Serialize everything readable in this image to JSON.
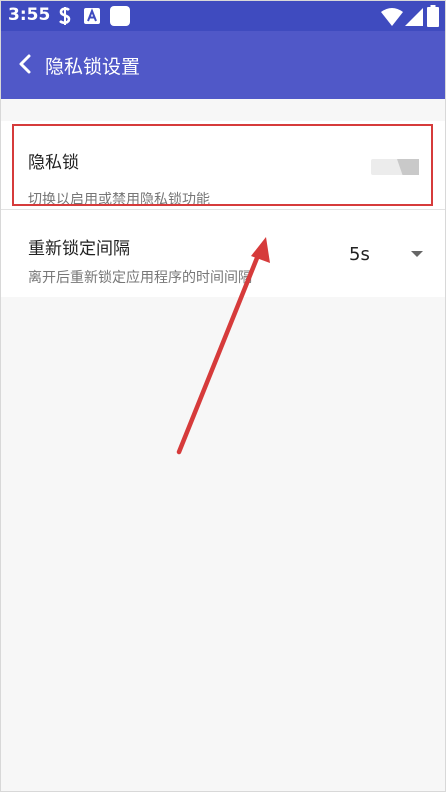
{
  "status_bar": {
    "time": "3:55",
    "icons": [
      "dollar-icon",
      "font-a-icon",
      "app-square-icon",
      "wifi-icon",
      "signal-icon",
      "battery-icon"
    ]
  },
  "app_bar": {
    "back_icon": "chevron-left-icon",
    "title": "隐私锁设置"
  },
  "settings": {
    "privacy_lock": {
      "title": "隐私锁",
      "summary": "切换以启用或禁用隐私锁功能",
      "enabled": false
    },
    "relock_interval": {
      "title": "重新锁定间隔",
      "summary": "离开后重新锁定应用程序的时间间隔",
      "value": "5s"
    }
  },
  "colors": {
    "status_bar": "#3f4bbf",
    "app_bar": "#5058c8",
    "annotation_red": "#d63b3b"
  }
}
